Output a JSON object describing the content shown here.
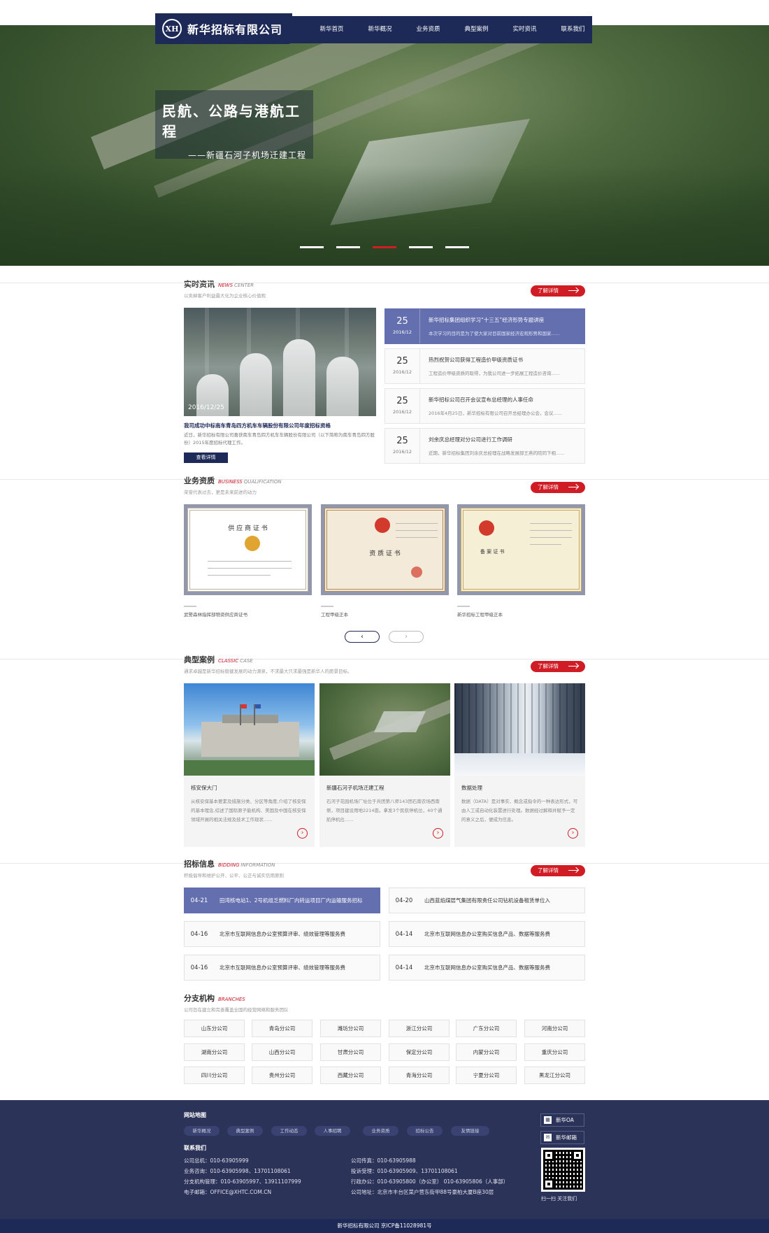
{
  "header": {
    "logo_mark": "XH",
    "logo_text": "新华招标有限公司",
    "nav": [
      "新华首页",
      "新华概况",
      "业务资质",
      "典型案例",
      "实时资讯",
      "联系我们"
    ]
  },
  "banner": {
    "title": "民航、公路与港航工程",
    "subtitle": "——新疆石河子机场迁建工程"
  },
  "news": {
    "title": "实时资讯",
    "title_en1": "NEWS",
    "title_en2": "CENTER",
    "desc": "以卖掉客户利益最大化为企业核心价值观",
    "more": "了解详情",
    "featured": {
      "date": "2016/12/25",
      "caption": "我司成功中标南车青岛四方机车车辆股份有限公司年度招标资格",
      "summary": "近日，新华招标有限公司喜获南车青岛四方机车车辆股份有限公司（以下简称为南车青岛四方股份）2015年度招标代理工作。",
      "button": "查看详情"
    },
    "items": [
      {
        "day": "25",
        "ym": "2016/12",
        "title": "新华招标集团组织学习“十三五”经济形势专题讲座",
        "summary": "本次学习的目的是为了使大家对目前国家经济宏观形势和国家......"
      },
      {
        "day": "25",
        "ym": "2016/12",
        "title": "热烈祝贺公司获得工程造价甲级资质证书",
        "summary": "工程造价甲级资质的取得，为我公司进一步拓展工程造价咨询......"
      },
      {
        "day": "25",
        "ym": "2016/12",
        "title": "新华招标公司召开会议宣布总经理的人事任命",
        "summary": "2016年4月25日，新华招标有限公司召开总经理办公会，会议......"
      },
      {
        "day": "25",
        "ym": "2016/12",
        "title": "刘余庆总经理对分公司进行工作调研",
        "summary": "近期，新华招标集团刘余庆总经理在战略发展部王燕的陪同下相......"
      }
    ]
  },
  "qual": {
    "title": "业务资质",
    "title_en1": "BUSINESS",
    "title_en2": "QUALIFICATION",
    "desc": "荣誉代表过去，更是未来前进的动力",
    "more": "了解详情",
    "items": [
      {
        "cert_title": "供 应 商 证 书",
        "caption": "武警森林指挥部物资供应商证书"
      },
      {
        "cert_title": "资 质 证 书",
        "caption": "工程甲级正本"
      },
      {
        "cert_title": "备 案 证 书",
        "caption": "新华招标工程甲级正本"
      }
    ],
    "prev": "‹",
    "next": "›"
  },
  "cases": {
    "title": "典型案例",
    "title_en1": "CLASSIC",
    "title_en2": "CASE",
    "desc": "通求卓越是新华招标稳健发展的动力源泉，不求最大只求最强是新华人的愿景目标。",
    "more": "了解详情",
    "items": [
      {
        "title": "核安保大门",
        "summary": "从核安保基本要素及措施分类、分区等角度,介绍了核安保的基本理念,综述了国际原子能机构、美国及中国在核安保领域开展的相关法规及技术工作现状......"
      },
      {
        "title": "新疆石河子机场迁建工程",
        "summary": "石河子花园机场厂址位于兵团第八师143团石南农场西南侧，项目建设用地2214亩。拿发3个民航停机位，40个通航停机位......"
      },
      {
        "title": "数据处理",
        "summary": "数据（DATA）是对事实、概念或指令的一种表达形式，可由人工或自动化装置进行处理。数据经过解释并赋予一定的意义之后，便成为信息。"
      }
    ],
    "go": "›"
  },
  "bidding": {
    "title": "招标信息",
    "title_en1": "BIDDING",
    "title_en2": "INFORMATION",
    "desc": "积极倡导和维护公开、公平、公正与诚实信用原则",
    "more": "了解详情",
    "items": [
      {
        "date": "04-21",
        "title": "田湾核电站1、2号机组乏燃料厂内转运项目厂内运输服务招标"
      },
      {
        "date": "04-20",
        "title": "山西蓝焰煤层气集团有限责任公司钻机设备租赁单位入"
      },
      {
        "date": "04-16",
        "title": "北京市互联网信息办公室预算评审、绩效管理等服务费"
      },
      {
        "date": "04-14",
        "title": "北京市互联网信息办公室购买信息产品、数据等服务费"
      },
      {
        "date": "04-16",
        "title": "北京市互联网信息办公室预算评审、绩效管理等服务费"
      },
      {
        "date": "04-14",
        "title": "北京市互联网信息办公室购买信息产品、数据等服务费"
      }
    ]
  },
  "branches": {
    "title": "分支机构",
    "title_en1": "BRANCHES",
    "desc": "公司旨在建立和完善覆盖全国的经营网络和服务团队",
    "items": [
      "山东分公司",
      "青岛分公司",
      "潍坊分公司",
      "浙江分公司",
      "广东分公司",
      "河南分公司",
      "湖南分公司",
      "山西分公司",
      "甘肃分公司",
      "保定分公司",
      "内蒙分公司",
      "重庆分公司",
      "四川分公司",
      "贵州分公司",
      "西藏分公司",
      "青海分公司",
      "宁夏分公司",
      "黑龙江分公司"
    ]
  },
  "footer": {
    "sitemap_title": "网站地图",
    "links": [
      "新华概况",
      "典型案例",
      "工作动态",
      "人事招聘",
      "业务资质",
      "招标公告",
      "友情链接"
    ],
    "contact_title": "联系我们",
    "contacts": [
      "公司总机：010-63905999",
      "公司传真：010-63905988",
      "业务咨询：010-63905998、13701108061",
      "投诉受理：010-63905909、13701108061",
      "分支机构管理：010-63905997、13911107999",
      "行政办公：010-63905800（办公室）    010-63905806（人事部）",
      "电子邮箱：OFFICE@XHTC.COM.CN",
      "公司地址：北京市丰台区菜户营东街甲88号豪柏大厦B座30层"
    ],
    "oa": "新华OA",
    "mail": "新华邮箱",
    "qr_caption": "扫一扫 关注我们",
    "copyright": "新华招标有限公司    京ICP备11028981号"
  }
}
